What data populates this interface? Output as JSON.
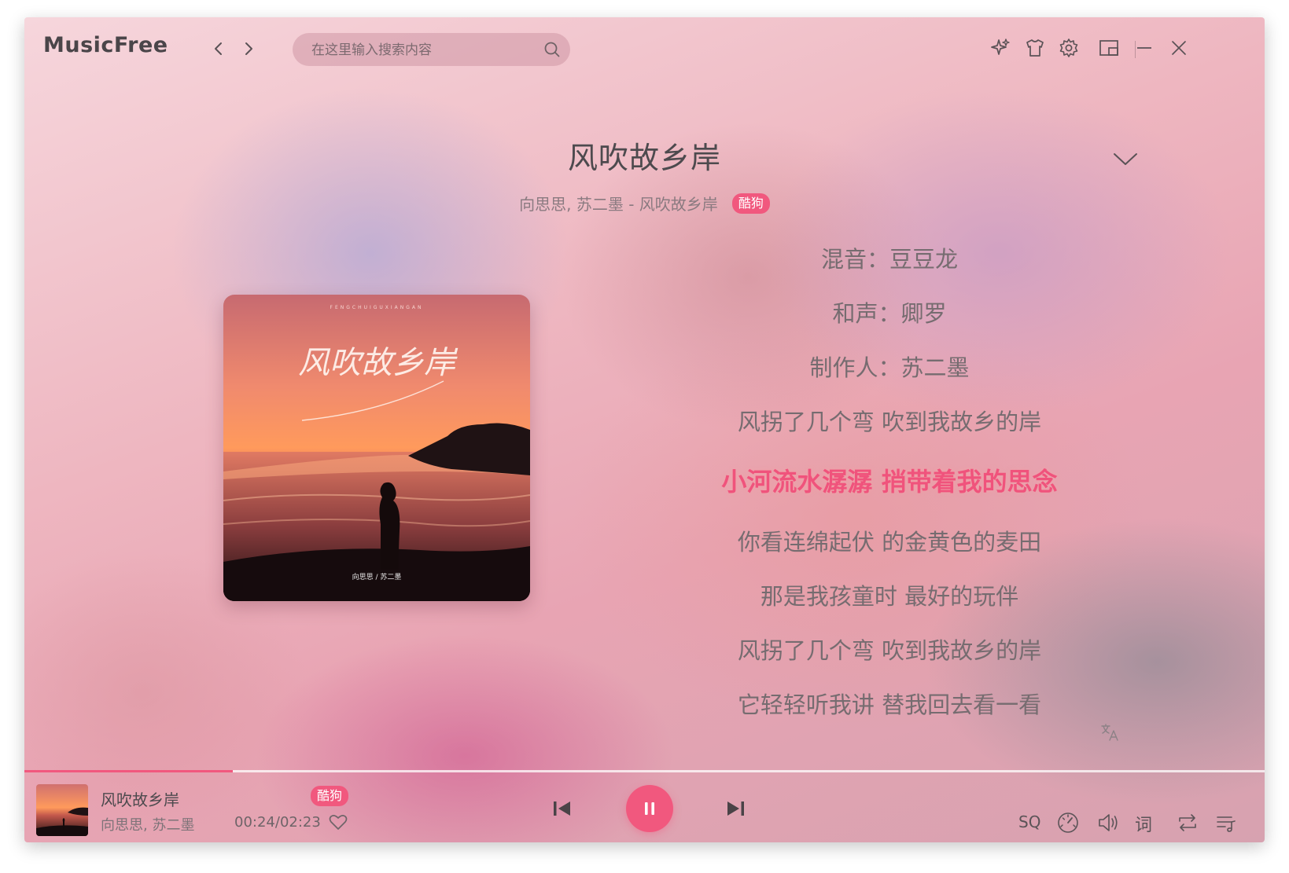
{
  "app": {
    "name": "MusicFree"
  },
  "search": {
    "placeholder": "在这里输入搜索内容"
  },
  "song": {
    "title": "风吹故乡岸",
    "subtitle": "向思思, 苏二墨 - 风吹故乡岸",
    "artists": "向思思, 苏二墨",
    "source": "酷狗"
  },
  "lyrics": {
    "lines": [
      "混音：豆豆龙",
      "和声：卿罗",
      "制作人：苏二墨",
      "风拐了几个弯 吹到我故乡的岸",
      "小河流水潺潺 捎带着我的思念",
      "你看连绵起伏 的金黄色的麦田",
      "那是我孩童时 最好的玩伴",
      "风拐了几个弯 吹到我故乡的岸",
      "它轻轻听我讲 替我回去看一看"
    ],
    "active_index": 4
  },
  "cover": {
    "art_title": "风吹故乡岸",
    "art_artists": "向思思 / 苏二墨",
    "art_top_text": "FENGCHUIGUXIANGAN"
  },
  "player": {
    "time": "00:24/02:23",
    "progress": 0.168,
    "quality": "SQ",
    "lyric_label": "词",
    "state": "playing"
  },
  "colors": {
    "accent": "#f1587e",
    "text": "#4d4a4e",
    "muted": "#7d7378"
  },
  "icons": {
    "titlebar": [
      "back-icon",
      "forward-icon",
      "search-icon",
      "sparkle-icon",
      "shirt-icon",
      "gear-icon",
      "mini-mode-icon",
      "minimize-icon",
      "close-icon"
    ],
    "player": [
      "previous-icon",
      "pause-icon",
      "next-icon",
      "heart-icon",
      "equalizer-icon",
      "volume-icon",
      "repeat-icon",
      "playlist-icon",
      "translate-icon",
      "chevron-down-icon"
    ]
  }
}
